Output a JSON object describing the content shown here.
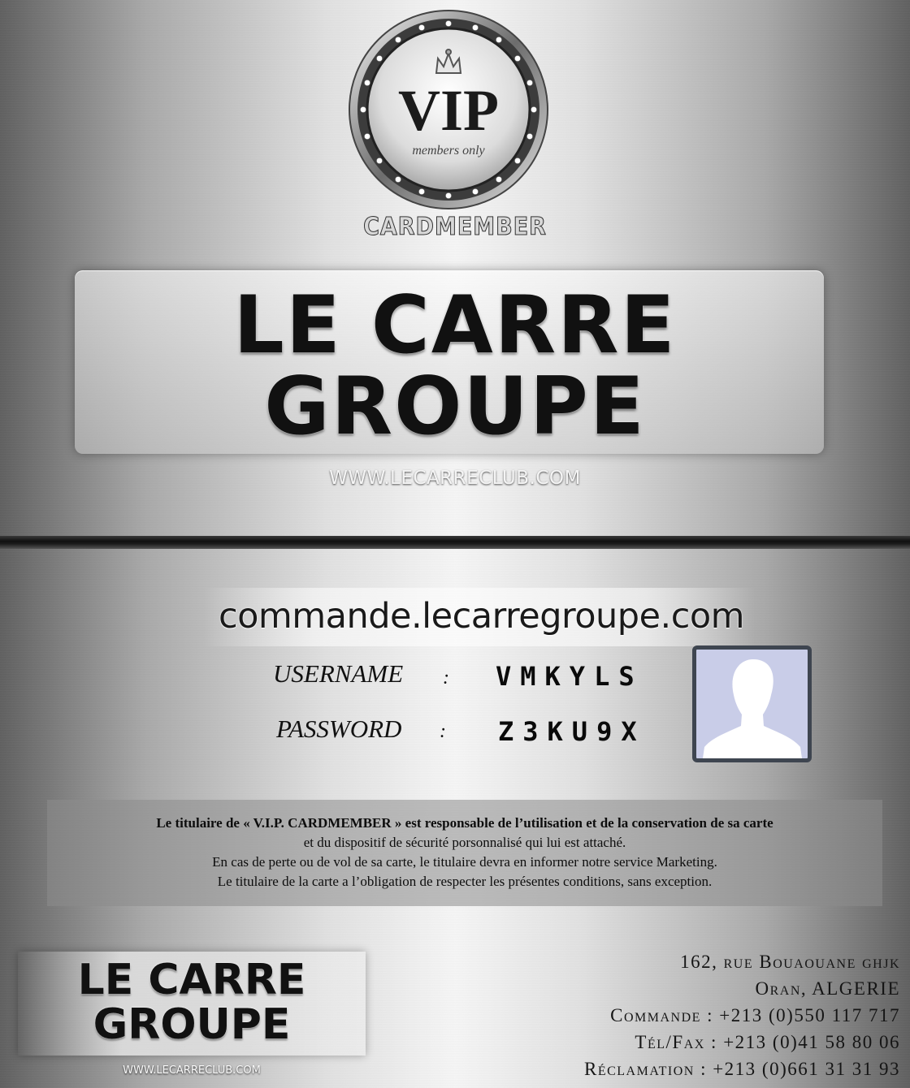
{
  "front": {
    "badge": {
      "main_text": "VIP",
      "sub_text": "members only",
      "icon": "crown-icon"
    },
    "cardmember_label": "CARDMEMBER",
    "title_line1": "LE CARRE",
    "title_line2": "GROUPE",
    "website": "WWW.LECARRECLUB.COM"
  },
  "back": {
    "order_url": "commande.lecarregroupe.com",
    "credentials": {
      "username_label": "USERNAME",
      "username_value": "VMKYLS",
      "password_label": "PASSWORD",
      "password_value": "Z3KU9X",
      "separator": ":"
    },
    "avatar_icon": "user-silhouette-icon",
    "terms": {
      "line1": "Le titulaire de « V.I.P. CARDMEMBER » est responsable de l’utilisation et de la conservation de sa carte",
      "line2": "et du dispositif de sécurité porsonnalisé qui lui est attaché.",
      "line3": "En cas de perte ou de vol de sa carte, le titulaire devra en informer notre service Marketing.",
      "line4": "Le titulaire de la carte a l’obligation de respecter les présentes conditions, sans exception."
    },
    "logo": {
      "line1": "LE CARRE",
      "line2": "GROUPE",
      "website": "WWW.LECARRECLUB.COM"
    },
    "address": {
      "street": "162, rue Bouaouane ghjk",
      "city": "Oran, ALGERIE",
      "commande": "Commande : +213 (0)550 117 717",
      "telfax": "Tél/Fax : +213 (0)41 58 80 06",
      "reclamation": "Réclamation : +213 (0)661 31 31 93"
    }
  }
}
